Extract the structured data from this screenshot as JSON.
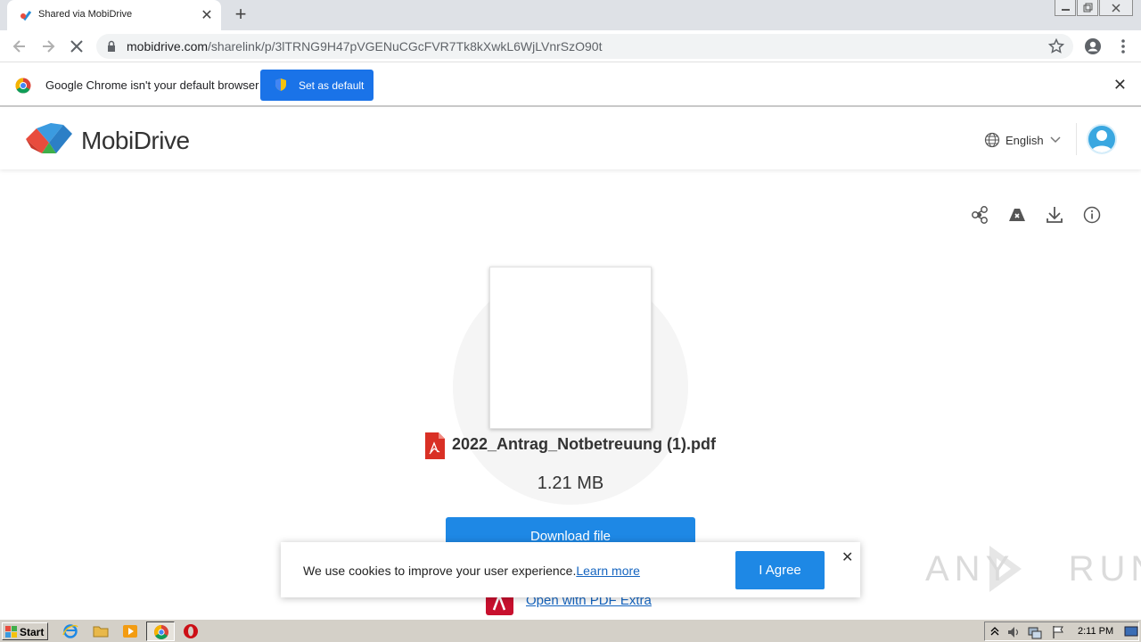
{
  "browser": {
    "tab": {
      "title": "Shared via MobiDrive",
      "close": "✕"
    },
    "new_tab": "+",
    "url_host": "mobidrive.com",
    "url_path": "/sharelink/p/3lTRNG9H47pVGENuCGcFVR7Tk8kXwkL6WjLVnrSzO90t",
    "infobar": {
      "message": "Google Chrome isn't your default browser",
      "button": "Set as default",
      "close": "✕"
    }
  },
  "site": {
    "brand": "MobiDrive",
    "language": "English",
    "file": {
      "name": "2022_Antrag_Notbetreuung (1).pdf",
      "size": "1.21 MB",
      "download_label": "Download file",
      "open_label": "Open with PDF Extra"
    },
    "cookie": {
      "text": "We use cookies to improve your user experience.",
      "link": "Learn more",
      "agree": "I Agree",
      "close": "✕"
    }
  },
  "watermark": "ANY RUN",
  "taskbar": {
    "start": "Start",
    "clock": "2:11 PM"
  },
  "colors": {
    "accent": "#1e88e5",
    "chrome_blue": "#1a73e8",
    "pdf_red": "#d93025"
  }
}
